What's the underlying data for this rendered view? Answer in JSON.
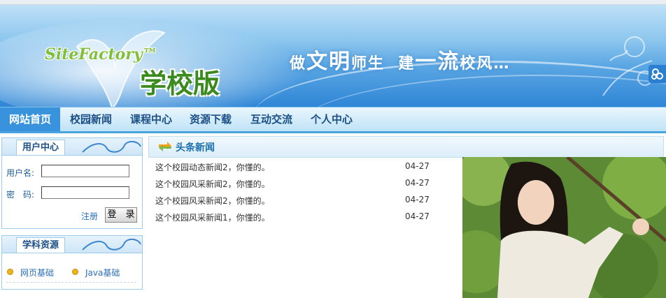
{
  "banner": {
    "brand": "SiteFactory™",
    "edition": "学校版",
    "slogan": {
      "p1": "做",
      "p2": "文明",
      "p3": "师生  建",
      "p4": "一流",
      "p5": "校风…"
    }
  },
  "nav": {
    "items": [
      {
        "label": "网站首页",
        "active": true
      },
      {
        "label": "校园新闻",
        "active": false
      },
      {
        "label": "课程中心",
        "active": false
      },
      {
        "label": "资源下载",
        "active": false
      },
      {
        "label": "互动交流",
        "active": false
      },
      {
        "label": "个人中心",
        "active": false
      }
    ]
  },
  "user_center": {
    "title": "用户中心",
    "username_label": "用户名:",
    "password_label": "密　码:",
    "username_value": "",
    "password_value": "",
    "register_label": "注册",
    "login_label": "登　录"
  },
  "resources": {
    "title": "学科资源",
    "items": [
      "网页基础",
      "Java基础"
    ]
  },
  "headline_news": {
    "title": "头条新闻",
    "rows": [
      {
        "title": "这个校园动态新闻2，你懂的。",
        "date": "04-27"
      },
      {
        "title": "这个校园风采新闻2，你懂的。",
        "date": "04-27"
      },
      {
        "title": "这个校园风采新闻2，你懂的。",
        "date": "04-27"
      },
      {
        "title": "这个校园风采新闻1，你懂的。",
        "date": "04-27"
      }
    ]
  },
  "colors": {
    "nav_active": "#3893dc",
    "link": "#2a6fb8",
    "title": "#1b4f86"
  },
  "icons": {
    "side_button": "share-icon",
    "head_news": "arrows-icon"
  }
}
